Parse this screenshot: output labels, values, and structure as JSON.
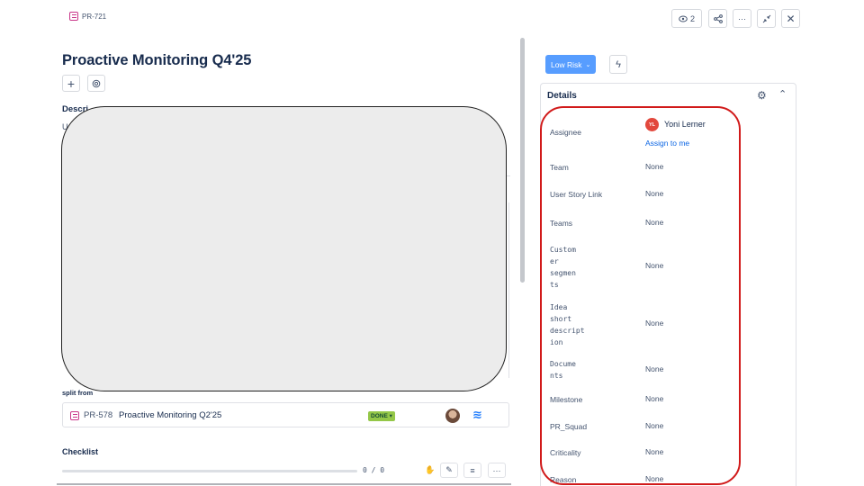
{
  "header": {
    "issue_key": "PR-721",
    "watchers_count": "2",
    "buttons": [
      "share",
      "more",
      "collapse",
      "close"
    ]
  },
  "issue": {
    "title": "Proactive Monitoring Q4'25",
    "description_label": "Descri",
    "description_text": "U"
  },
  "linked_issues": {
    "label": "split from",
    "items": [
      {
        "key": "PR-578",
        "summary": "Proactive Monitoring Q2'25",
        "status": "DONE ▾"
      }
    ]
  },
  "checklist": {
    "label": "Checklist",
    "progress_text": "0 / 0",
    "progress": 0
  },
  "sidebar": {
    "risk_label": "Low Risk",
    "details_title": "Details",
    "assignee": {
      "label": "Assignee",
      "initials": "YL",
      "name": "Yoni Lerner",
      "assign_link": "Assign to me"
    },
    "fields": [
      {
        "label": "Team",
        "value": "None"
      },
      {
        "label": "User Story Link",
        "value": "None"
      },
      {
        "label": "Teams",
        "value": "None"
      },
      {
        "label": "Custom\ner\nsegmen\nts",
        "value": "None"
      },
      {
        "label": "Idea\nshort\ndescript\nion",
        "value": "None"
      },
      {
        "label": "Docume\nnts",
        "value": "None"
      },
      {
        "label": "Milestone",
        "value": "None"
      },
      {
        "label": "PR_Squad",
        "value": "None"
      },
      {
        "label": "Criticality",
        "value": "None"
      },
      {
        "label": "Reason",
        "value": "None"
      }
    ]
  },
  "colors": {
    "accent": "#579dff",
    "link": "#0c66e4",
    "done": "#94c748",
    "highlight": "#d11a1a"
  }
}
